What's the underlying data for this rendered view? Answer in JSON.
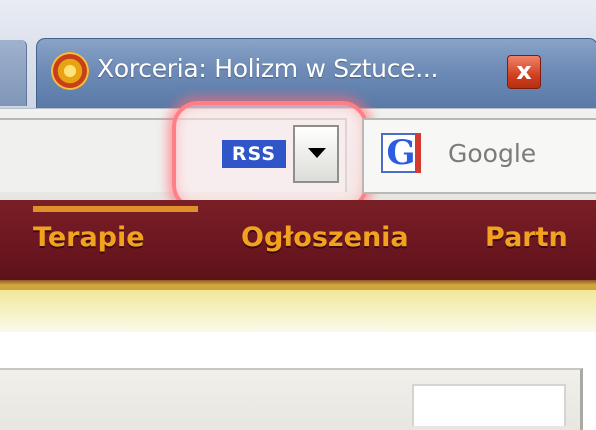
{
  "browser": {
    "tabs": [
      {
        "title": "Xorceria: Holizm w Sztuce...",
        "active": true,
        "icon": "site-favicon"
      }
    ],
    "tab_close_label": "x",
    "toolbar": {
      "rss_label": "RSS",
      "search_engine_icon_letter": "G",
      "search_engine_label": "Google",
      "rss_highlight_color": "#ff7f86"
    }
  },
  "site": {
    "nav_items": [
      "Terapie",
      "Ogłoszenia",
      "Partn"
    ],
    "nav_color": "#f2a21e",
    "nav_background": "#6b1620"
  }
}
